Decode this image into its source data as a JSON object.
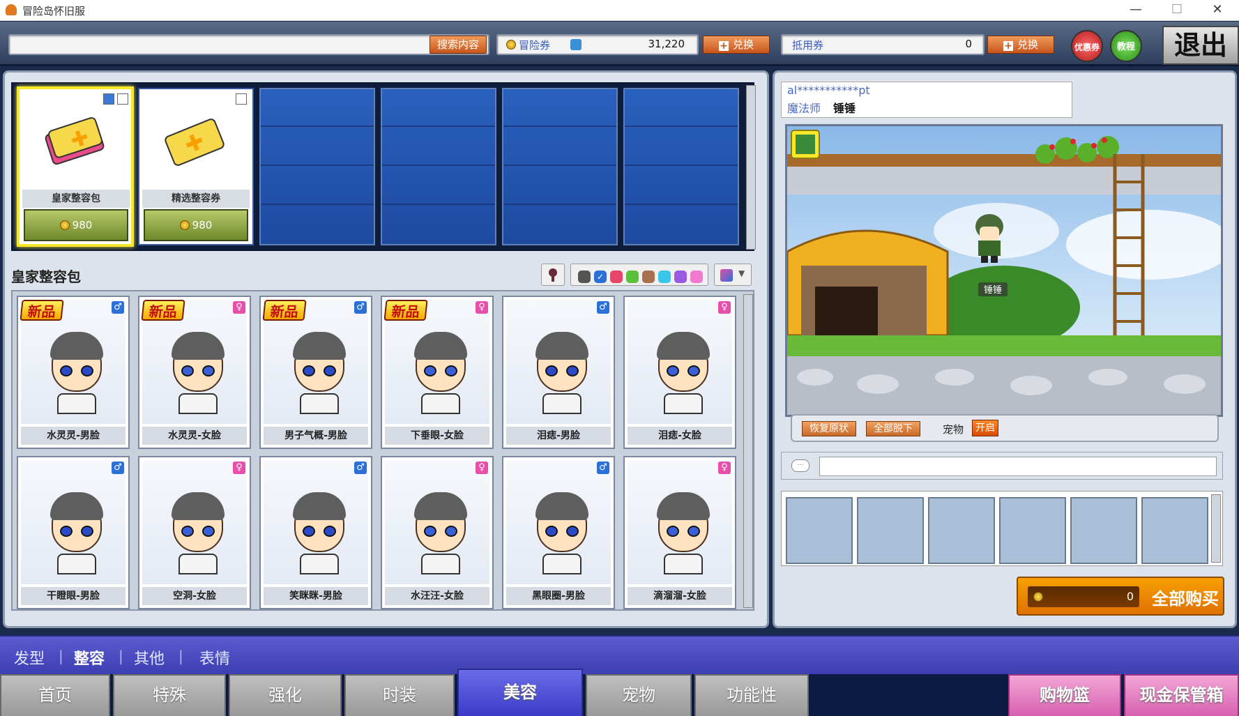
{
  "window": {
    "title": "冒险岛怀旧服",
    "minimize": "—",
    "maximize": "☐",
    "close": "✕"
  },
  "topbar": {
    "search_button": "搜索内容",
    "maple_coupon_label": "冒险券",
    "maple_coupon_value": "31,220",
    "exchange1": "兑换",
    "point_coupon_label": "抵用券",
    "point_coupon_value": "0",
    "exchange2": "兑换",
    "discount_button": "优惠券",
    "tutorial_button": "教程",
    "exit_button": "退出"
  },
  "featured": [
    {
      "name": "皇家整容包",
      "price": "980"
    },
    {
      "name": "精选整容券",
      "price": "980"
    }
  ],
  "section_title": "皇家整容包",
  "filter_colors": [
    "#555555",
    "#2b6fd8",
    "#e8456a",
    "#5ac03a",
    "#a87050",
    "#3ac6e8",
    "#9a5ae0",
    "#f07ad0"
  ],
  "new_label": "新品",
  "faces": [
    {
      "label": "水灵灵-男脸",
      "gender": "♂",
      "new": true
    },
    {
      "label": "水灵灵-女脸",
      "gender": "♀",
      "new": true
    },
    {
      "label": "男子气概-男脸",
      "gender": "♂",
      "new": true
    },
    {
      "label": "下垂眼-女脸",
      "gender": "♀",
      "new": true
    },
    {
      "label": "泪痣-男脸",
      "gender": "♂",
      "new": false
    },
    {
      "label": "泪痣-女脸",
      "gender": "♀",
      "new": false
    },
    {
      "label": "干瞪眼-男脸",
      "gender": "♂",
      "new": false
    },
    {
      "label": "空洞-女脸",
      "gender": "♀",
      "new": false
    },
    {
      "label": "笑眯眯-男脸",
      "gender": "♂",
      "new": false
    },
    {
      "label": "水汪汪-女脸",
      "gender": "♀",
      "new": false
    },
    {
      "label": "黑眼圈-男脸",
      "gender": "♂",
      "new": false
    },
    {
      "label": "滴溜溜-女脸",
      "gender": "♀",
      "new": false
    }
  ],
  "account": {
    "id": "al***********pt",
    "job": "魔法师",
    "name": "锤锤"
  },
  "preview": {
    "char_name": "锤锤",
    "restore": "恢复原状",
    "undress_all": "全部脱下",
    "pet_label": "宠物",
    "pet_toggle": "开启"
  },
  "cart": {
    "total": "0",
    "buy_all": "全部购买"
  },
  "subnav": [
    "发型",
    "整容",
    "其他",
    "表情"
  ],
  "tabs": [
    "首页",
    "特殊",
    "强化",
    "时装",
    "美容",
    "宠物",
    "功能性",
    "购物篮",
    "现金保管箱"
  ]
}
